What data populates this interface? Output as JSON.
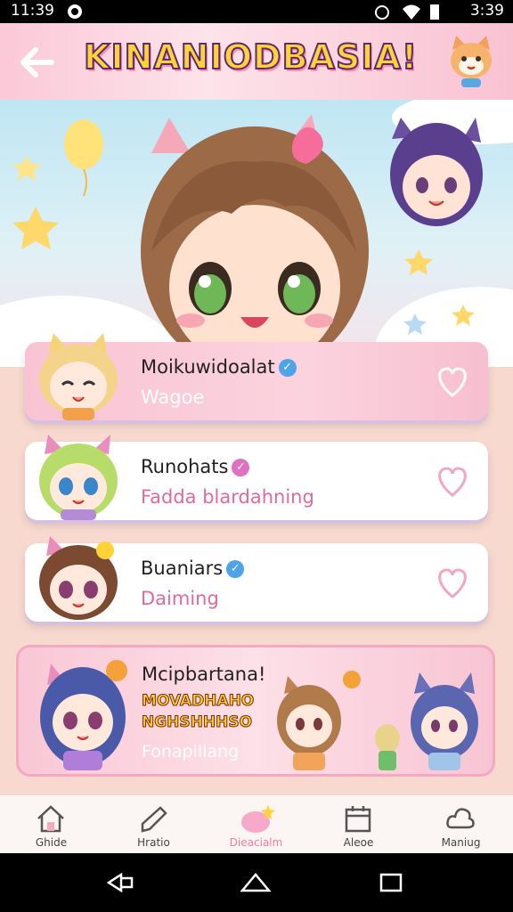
{
  "status_bar": {
    "time": "11:39",
    "clock_right": "3:39"
  },
  "header": {
    "title": "KINANIODBASIA!"
  },
  "cards": [
    {
      "name": "Moikuwidoalat",
      "subtitle": "Wagoe",
      "verified_color": "#4fa3e8"
    },
    {
      "name": "Runohats",
      "subtitle": "Fadda blardahning",
      "verified_color": "#e070c0"
    },
    {
      "name": "Buaniars",
      "subtitle": "Daiming",
      "verified_color": "#4fa3e8"
    }
  ],
  "featured": {
    "name": "Mcipbartana!",
    "promo_line1": "MOVADHAHO",
    "promo_line2": "NGHSHHHSO",
    "subtitle": "Fonapillang"
  },
  "bottom_nav": [
    {
      "label": "Ghide",
      "icon": "home-icon"
    },
    {
      "label": "Hratio",
      "icon": "chat-icon"
    },
    {
      "label": "Dieacialm",
      "icon": "sparkle-icon",
      "active": true
    },
    {
      "label": "Aleoe",
      "icon": "calendar-icon"
    },
    {
      "label": "Maniug",
      "icon": "cloud-icon"
    }
  ],
  "colors": {
    "accent_pink": "#f47aa6",
    "header_bg": "#fbc9d8",
    "title_yellow": "#ffd23a"
  }
}
